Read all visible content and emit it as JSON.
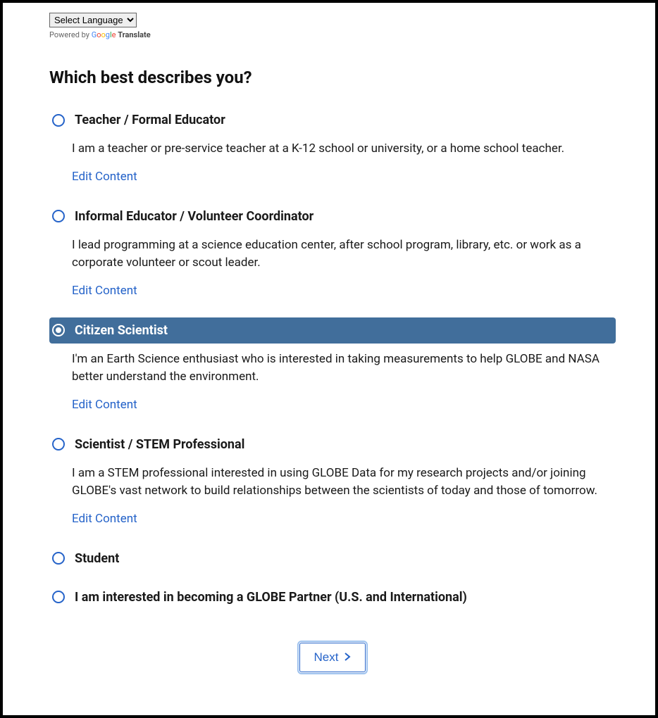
{
  "lang": {
    "selected": "Select Language",
    "powered_prefix": "Powered by ",
    "google_letters": [
      "G",
      "o",
      "o",
      "g",
      "l",
      "e"
    ],
    "translate_word": "Translate"
  },
  "question": "Which best describes you?",
  "edit_label": "Edit Content",
  "options": [
    {
      "title": "Teacher / Formal Educator",
      "desc": "I am a teacher or pre-service teacher at a K-12 school or university, or a home school teacher.",
      "has_edit": true,
      "selected": false
    },
    {
      "title": "Informal Educator / Volunteer Coordinator",
      "desc": "I lead programming at a science education center, after school program, library, etc. or work as a corporate volunteer or scout leader.",
      "has_edit": true,
      "selected": false
    },
    {
      "title": "Citizen Scientist",
      "desc": "I'm an Earth Science enthusiast who is interested in taking measurements to help GLOBE and NASA better understand the environment.",
      "has_edit": true,
      "selected": true
    },
    {
      "title": "Scientist / STEM Professional",
      "desc": "I am a STEM professional interested in using GLOBE Data for my research projects and/or joining GLOBE's vast network to build relationships between the scientists of today and those of tomorrow.",
      "has_edit": true,
      "selected": false
    },
    {
      "title": "Student",
      "desc": "",
      "has_edit": false,
      "selected": false
    },
    {
      "title": "I am interested in becoming a GLOBE Partner (U.S. and International)",
      "desc": "",
      "has_edit": false,
      "selected": false
    }
  ],
  "next_label": "Next"
}
